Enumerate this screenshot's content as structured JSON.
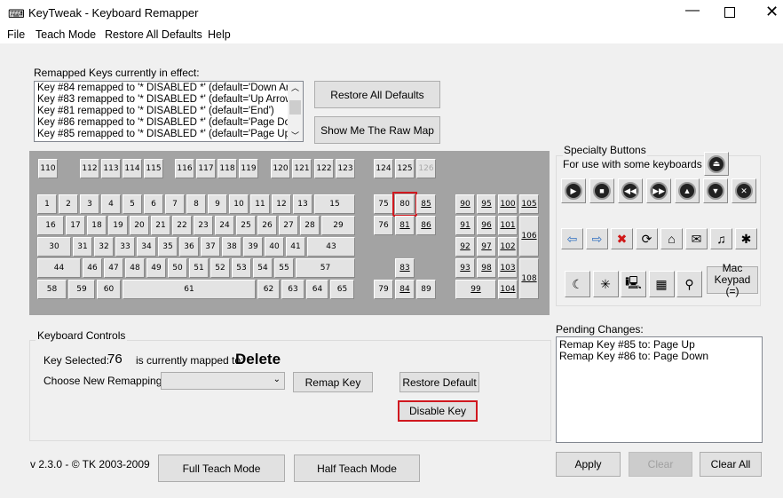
{
  "window": {
    "title": "KeyTweak -  Keyboard Remapper",
    "icon": "keyboard-icon"
  },
  "menu": [
    "File",
    "Teach Mode",
    "Restore All Defaults",
    "Help"
  ],
  "remapped": {
    "label": "Remapped Keys currently in effect:",
    "items": [
      "Key #84 remapped to '* DISABLED *' (default='Down Arrow'",
      "Key #83 remapped to '* DISABLED *' (default='Up Arrow')",
      "Key #81 remapped to '* DISABLED *' (default='End')",
      "Key #86 remapped to '* DISABLED *' (default='Page Down'",
      "Key #85 remapped to '* DISABLED *' (default='Page Up')"
    ],
    "restore_all": "Restore All Defaults",
    "raw_map": "Show Me The Raw Map"
  },
  "keyboard": {
    "selected_key": "80",
    "mapped_keys": [
      "85",
      "81",
      "86",
      "83",
      "84",
      "90",
      "95",
      "100",
      "105",
      "91",
      "96",
      "101",
      "106",
      "92",
      "97",
      "102",
      "93",
      "98",
      "103",
      "108",
      "99",
      "104"
    ],
    "disabled_keys": [
      "126"
    ],
    "top": [
      "110",
      "112",
      "113",
      "114",
      "115",
      "116",
      "117",
      "118",
      "119",
      "120",
      "121",
      "122",
      "123",
      "124",
      "125",
      "126"
    ],
    "rows": [
      [
        "1",
        "2",
        "3",
        "4",
        "5",
        "6",
        "7",
        "8",
        "9",
        "10",
        "11",
        "12",
        "13",
        "15"
      ],
      [
        "16",
        "17",
        "18",
        "19",
        "20",
        "21",
        "22",
        "23",
        "24",
        "25",
        "26",
        "27",
        "28",
        "29"
      ],
      [
        "30",
        "31",
        "32",
        "33",
        "34",
        "35",
        "36",
        "37",
        "38",
        "39",
        "40",
        "41",
        "43"
      ],
      [
        "44",
        "46",
        "47",
        "48",
        "49",
        "50",
        "51",
        "52",
        "53",
        "54",
        "55",
        "57"
      ],
      [
        "58",
        "59",
        "60",
        "61",
        "62",
        "63",
        "64",
        "65"
      ]
    ],
    "nav": [
      "75",
      "80",
      "85",
      "76",
      "81",
      "86",
      "83",
      "79",
      "84",
      "89"
    ],
    "numpad": [
      "90",
      "95",
      "100",
      "105",
      "91",
      "96",
      "101",
      "106",
      "92",
      "97",
      "102",
      "93",
      "98",
      "103",
      "108",
      "99",
      "104"
    ]
  },
  "specialty": {
    "title": "Specialty Buttons",
    "subtitle": "For use with some keyboards",
    "row0": [
      "eject-icon"
    ],
    "row1": [
      "play-icon",
      "stop-icon",
      "rewind-icon",
      "fast-forward-icon",
      "volume-up-icon",
      "volume-down-icon",
      "mute-icon"
    ],
    "row2": [
      "back-arrow-icon",
      "forward-arrow-icon",
      "stop-browser-icon",
      "refresh-icon",
      "home-icon",
      "mail-icon",
      "media-icon",
      "favorites-folder-icon"
    ],
    "row3": [
      "sleep-icon",
      "wake-icon",
      "my-computer-icon",
      "calculator-icon",
      "search-icon"
    ],
    "mac_keypad": "Mac Keypad (=)"
  },
  "controls": {
    "title": "Keyboard Controls",
    "key_selected_label": "Key Selected:",
    "key_selected_value": "76",
    "mapped_to_label": "is currently mapped to:",
    "mapped_to_value": "Delete",
    "choose_label": "Choose New Remapping",
    "choose_value": "",
    "remap": "Remap Key",
    "restore_default": "Restore Default",
    "disable": "Disable Key"
  },
  "pending": {
    "label": "Pending Changes:",
    "items": [
      "Remap Key #85 to: Page Up",
      "Remap Key #86 to: Page Down"
    ]
  },
  "footer": {
    "version": "v 2.3.0 - © TK 2003-2009",
    "full_teach": "Full Teach Mode",
    "half_teach": "Half Teach Mode",
    "apply": "Apply",
    "clear": "Clear",
    "clear_all": "Clear All"
  },
  "colors": {
    "highlight": "#d0181f",
    "keyboard_bg": "#a3a3a3"
  }
}
